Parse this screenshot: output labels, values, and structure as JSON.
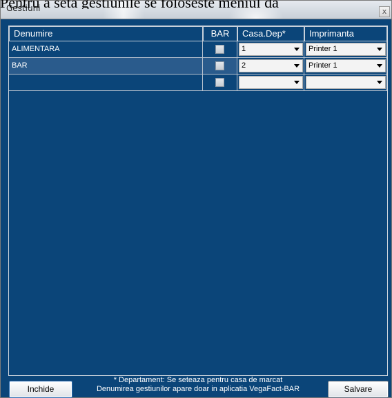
{
  "background_text": "Pentru a seta gestiunile se foloseste meniul da",
  "window": {
    "title": "Gestiuni",
    "close_glyph": "x"
  },
  "grid": {
    "columns": [
      "Denumire",
      "BAR",
      "Casa.Dep*",
      "Imprimanta"
    ],
    "rows": [
      {
        "denumire": "ALIMENTARA",
        "bar": false,
        "casa": "1",
        "imprimanta": "Printer 1",
        "selected": false
      },
      {
        "denumire": "BAR",
        "bar": false,
        "casa": "2",
        "imprimanta": "Printer 1",
        "selected": true
      },
      {
        "denumire": "",
        "bar": false,
        "casa": "",
        "imprimanta": "",
        "selected": false
      }
    ]
  },
  "footer": {
    "note_line1": "* Departament: Se seteaza pentru casa de marcat",
    "note_line2": "Denumirea gestiunilor apare doar in aplicatia VegaFact-BAR",
    "close_label": "Inchide",
    "save_label": "Salvare"
  },
  "colors": {
    "window_bg": "#0b4579",
    "selected_row": "#2a5b8c"
  }
}
